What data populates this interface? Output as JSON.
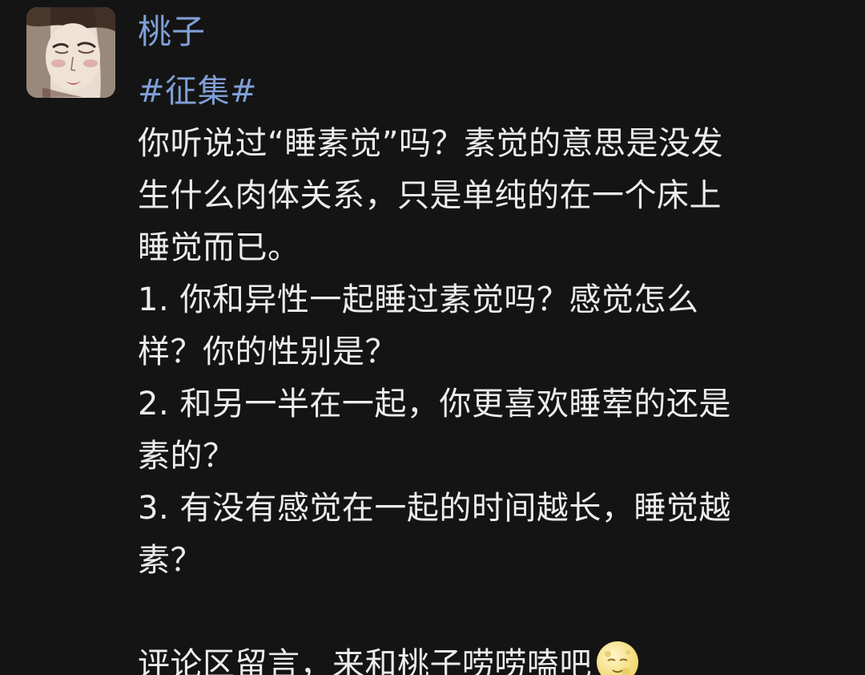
{
  "post": {
    "username": "桃子",
    "tag": "#征集#",
    "lines": [
      "你听说过“睡素觉”吗？素觉的意思是没发",
      "生什么肉体关系，只是单纯的在一个床上",
      "睡觉而已。",
      "1. 你和异性一起睡过素觉吗？感觉怎么",
      "样？你的性别是？",
      "2. 和另一半在一起，你更喜欢睡荤的还是",
      "素的？",
      "3. 有没有感觉在一起的时间越长，睡觉越",
      "素？"
    ],
    "closing": "评论区留言，来和桃子唠唠嗑吧",
    "closing_emoji": "full-moon-face-icon"
  },
  "colors": {
    "background": "#141414",
    "link": "#7f9fd6",
    "text": "#ececec"
  }
}
